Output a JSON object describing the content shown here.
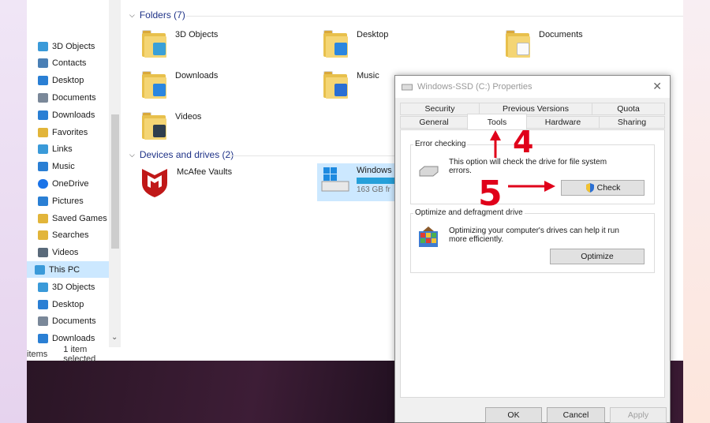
{
  "nav": {
    "items": [
      {
        "label": "3D Objects",
        "icon": "cube-icon",
        "color": "#3a9ad9"
      },
      {
        "label": "Contacts",
        "icon": "contacts-icon",
        "color": "#4a7fb5"
      },
      {
        "label": "Desktop",
        "icon": "desktop-icon",
        "color": "#2a7fd4"
      },
      {
        "label": "Documents",
        "icon": "documents-icon",
        "color": "#7a8899"
      },
      {
        "label": "Downloads",
        "icon": "download-arrow-icon",
        "color": "#2a7fd4"
      },
      {
        "label": "Favorites",
        "icon": "star-icon",
        "color": "#e2b53a"
      },
      {
        "label": "Links",
        "icon": "link-icon",
        "color": "#3a9ad9"
      },
      {
        "label": "Music",
        "icon": "music-note-icon",
        "color": "#2a7fd4"
      },
      {
        "label": "OneDrive",
        "icon": "cloud-icon",
        "color": "#1a73e8"
      },
      {
        "label": "Pictures",
        "icon": "pictures-icon",
        "color": "#2a7fd4"
      },
      {
        "label": "Saved Games",
        "icon": "gamepad-icon",
        "color": "#e2b53a"
      },
      {
        "label": "Searches",
        "icon": "search-icon",
        "color": "#e2b53a"
      },
      {
        "label": "Videos",
        "icon": "film-icon",
        "color": "#5a6a7a"
      },
      {
        "label": "This PC",
        "icon": "computer-icon",
        "color": "#3a9ad9"
      },
      {
        "label": "3D Objects",
        "icon": "cube-icon",
        "color": "#3a9ad9"
      },
      {
        "label": "Desktop",
        "icon": "desktop-icon",
        "color": "#2a7fd4"
      },
      {
        "label": "Documents",
        "icon": "documents-icon",
        "color": "#7a8899"
      },
      {
        "label": "Downloads",
        "icon": "download-arrow-icon",
        "color": "#2a7fd4"
      }
    ],
    "selected_label": "This PC"
  },
  "status": {
    "items_text": "items",
    "selected_text": "1 item selected"
  },
  "content": {
    "folders_header": "Folders (7)",
    "folders": [
      {
        "label": "3D Objects",
        "overlay": "cube-icon"
      },
      {
        "label": "Desktop",
        "overlay": "desktop-icon"
      },
      {
        "label": "Documents",
        "overlay": "documents-icon"
      },
      {
        "label": "Downloads",
        "overlay": "download-arrow-icon"
      },
      {
        "label": "Music",
        "overlay": "music-note-icon"
      },
      {
        "label": "Videos",
        "overlay": "film-icon"
      }
    ],
    "devices_header": "Devices and drives (2)",
    "devices": [
      {
        "label": "McAfee Vaults",
        "icon": "mcafee-shield-icon"
      },
      {
        "label": "Windows",
        "sub": "163 GB fr",
        "icon": "windows-drive-icon"
      }
    ]
  },
  "dialog": {
    "title": "Windows-SSD (C:) Properties",
    "tabs_row1": [
      "Security",
      "Previous Versions",
      "Quota"
    ],
    "tabs_row2": [
      "General",
      "Tools",
      "Hardware",
      "Sharing"
    ],
    "active_tab": "Tools",
    "error_checking": {
      "title": "Error checking",
      "text": "This option will check the drive for file system errors.",
      "button": "Check",
      "button_icon": "uac-shield-icon"
    },
    "optimize": {
      "title": "Optimize and defragment drive",
      "text": "Optimizing your computer's drives can help it run more efficiently.",
      "button": "Optimize"
    },
    "footer": {
      "ok": "OK",
      "cancel": "Cancel",
      "apply": "Apply"
    }
  },
  "annotations": {
    "step4": "4",
    "step5": "5",
    "color": "#e0001a"
  },
  "colors": {
    "selection": "#cce8ff",
    "group_header": "#1e3287",
    "folder": "#f4d574"
  }
}
